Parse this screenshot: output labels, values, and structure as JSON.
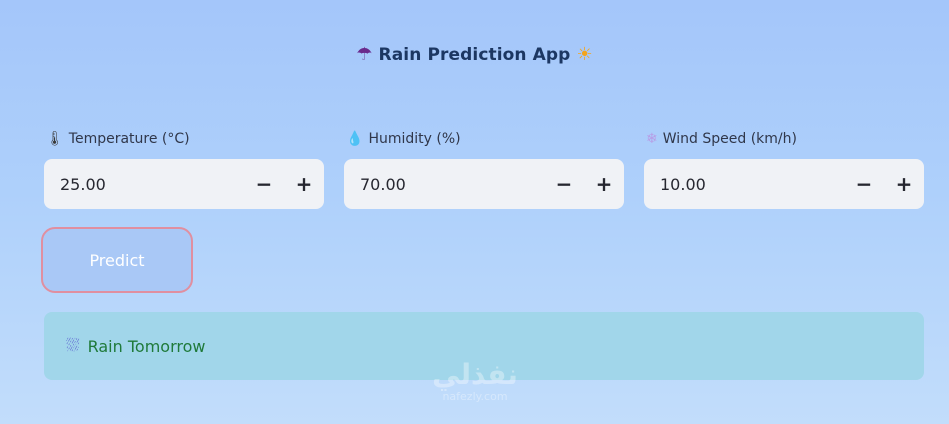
{
  "header": {
    "icon_left": "☂",
    "title": "Rain Prediction App",
    "icon_right": "☀"
  },
  "fields": [
    {
      "icon": "🌡",
      "label": "Temperature (°C)",
      "value": "25.00",
      "decrement": "−",
      "increment": "+"
    },
    {
      "icon": "💧",
      "label": "Humidity (%)",
      "value": "70.00",
      "decrement": "−",
      "increment": "+"
    },
    {
      "icon": "❄",
      "label": "Wind Speed (km/h)",
      "value": "10.00",
      "decrement": "−",
      "increment": "+"
    }
  ],
  "predict_button": {
    "label": "Predict"
  },
  "result": {
    "icon": "⛆",
    "text": "Rain Tomorrow"
  },
  "watermark": {
    "main": "نفذلي",
    "sub": "nafezly.com"
  }
}
